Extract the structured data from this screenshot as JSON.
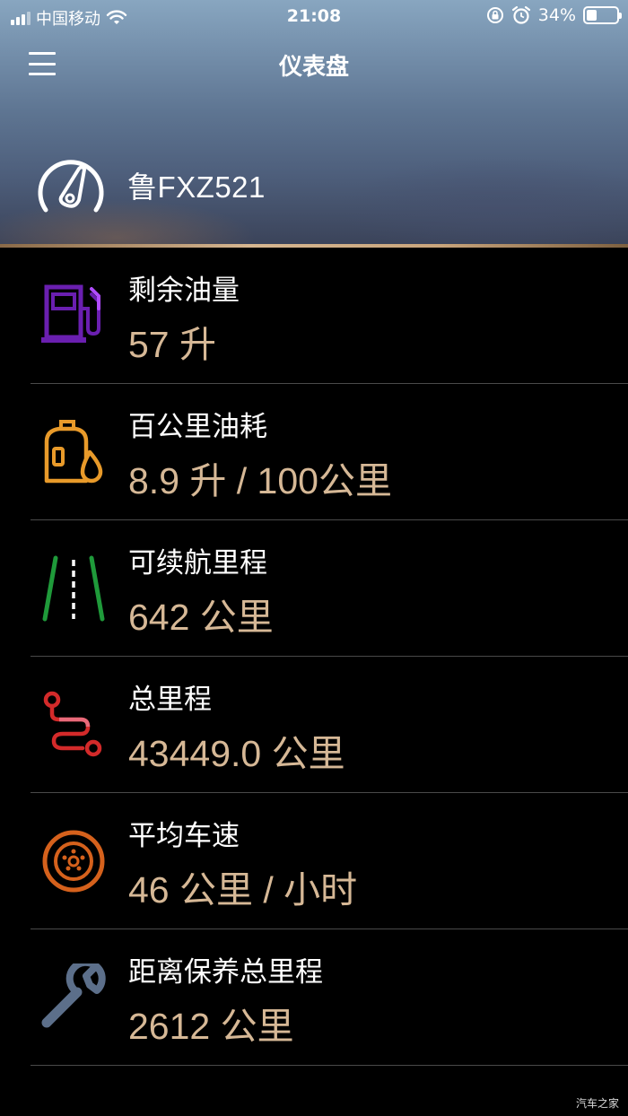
{
  "status_bar": {
    "carrier": "中国移动",
    "time": "21:08",
    "battery_percent_label": "34%",
    "battery_level": 0.34,
    "icons": [
      "signal-icon",
      "wifi-icon",
      "rotation-lock-icon",
      "alarm-icon",
      "battery-icon"
    ]
  },
  "header": {
    "title": "仪表盘",
    "plate": "鲁FXZ521"
  },
  "metrics": [
    {
      "label": "剩余油量",
      "value": "57 升",
      "icon": "fuel-pump-icon",
      "color": "#6a1fb0"
    },
    {
      "label": "百公里油耗",
      "value": "8.9 升 / 100公里",
      "icon": "oil-bottle-icon",
      "color": "#e89a2a"
    },
    {
      "label": "可续航里程",
      "value": "642 公里",
      "icon": "road-icon",
      "color": "#1f9a3a"
    },
    {
      "label": "总里程",
      "value": "43449.0 公里",
      "icon": "route-icon",
      "color": "#d32a2a"
    },
    {
      "label": "平均车速",
      "value": "46 公里 / 小时",
      "icon": "wheel-icon",
      "color": "#d5611c"
    },
    {
      "label": "距离保养总里程",
      "value": "2612 公里",
      "icon": "wrench-icon",
      "color": "#5c6f8a"
    }
  ],
  "watermark": "汽车之家",
  "colors": {
    "value_text": "#d6b896",
    "accent_line": "#d7b791",
    "background": "#000000"
  }
}
